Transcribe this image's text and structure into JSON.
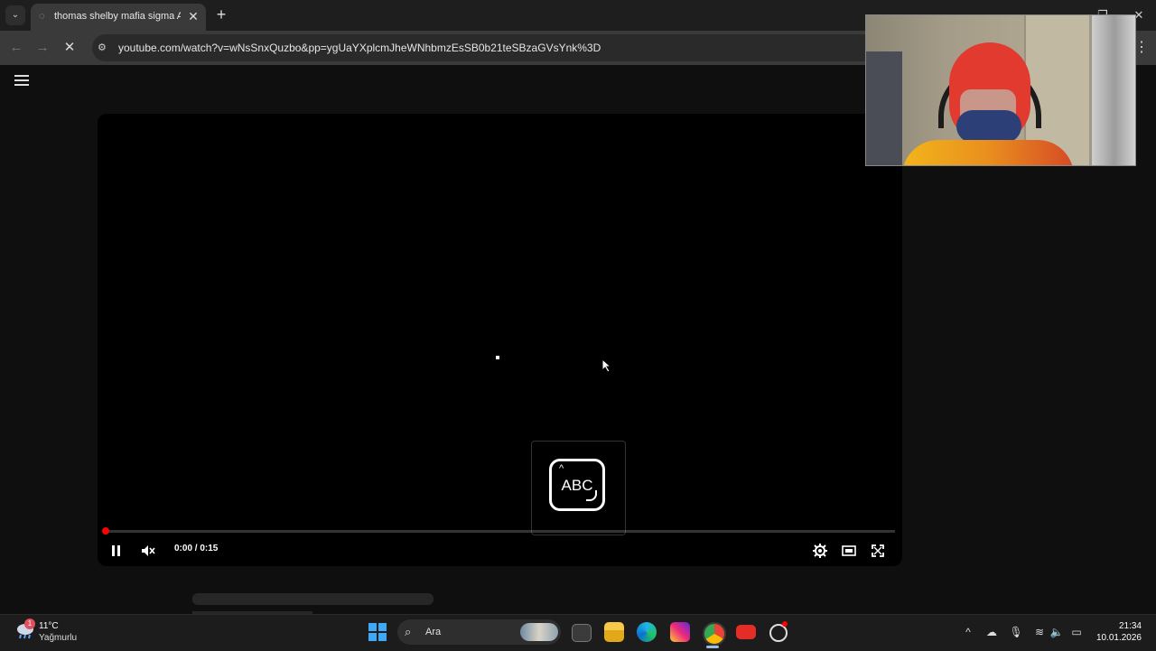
{
  "browser": {
    "tab_title": "thomas shelby mafia sigma Aze",
    "tab_close": "✕",
    "new_tab": "+",
    "url": "youtube.com/watch?v=wNsSnxQuzbo&pp=ygUaYXplcmJheWNhbmzEsSB0b21teSBzaGVsYnk%3D",
    "back": "←",
    "forward": "→",
    "reload": "✕",
    "menu": "⋮",
    "minimize": "—",
    "maximize": "❐",
    "close": "✕"
  },
  "player": {
    "time": "0:00 / 0:15",
    "progress": 0.0,
    "caption_badge": "ABC",
    "icons": [
      "pause-icon",
      "muted-icon",
      "settings-icon",
      "theater-icon",
      "fullscreen-icon"
    ]
  },
  "taskbar": {
    "weather_temp": "11°C",
    "weather_condition": "Yağmurlu",
    "weather_badge": "1",
    "search_label": "Ara",
    "clock_time": "21:34",
    "clock_date": "10.01.2026",
    "apps": [
      "task-view",
      "file-explorer",
      "edge",
      "instagram",
      "chrome",
      "youtube",
      "settings"
    ]
  },
  "colors": {
    "accent_red": "#ff0000",
    "windows_blue": "#3fa9f5"
  }
}
